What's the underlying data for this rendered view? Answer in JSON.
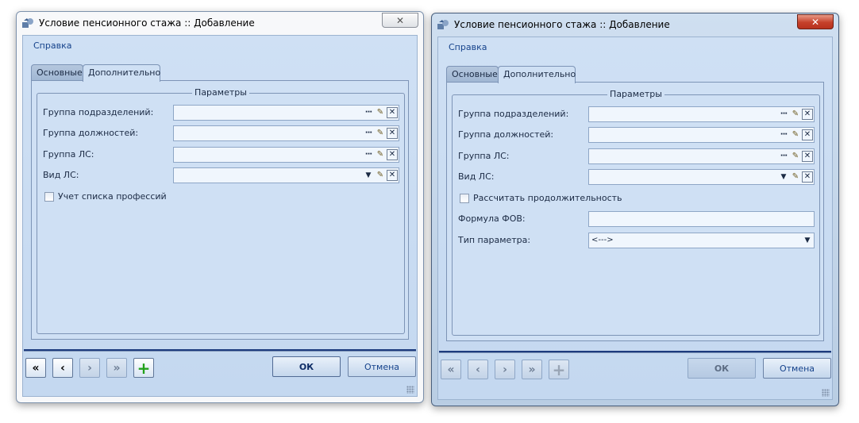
{
  "windows": [
    {
      "title": "Условие пенсионного стажа :: Добавление",
      "menu_item": "Справка",
      "tabs": [
        "Основные",
        "Дополнительно"
      ],
      "group_title": "Параметры",
      "fields": [
        {
          "label": "Группа подразделений:",
          "value": ""
        },
        {
          "label": "Группа должностей:",
          "value": ""
        },
        {
          "label": "Группа ЛС:",
          "value": ""
        },
        {
          "label": "Вид ЛС:",
          "value": ""
        }
      ],
      "checkbox_label": "Учет списка профессий",
      "ok_label": "ОК",
      "cancel_label": "Отмена"
    },
    {
      "title": "Условие пенсионного стажа :: Добавление",
      "menu_item": "Справка",
      "tabs": [
        "Основные",
        "Дополнительно"
      ],
      "group_title": "Параметры",
      "fields": [
        {
          "label": "Группа подразделений:",
          "value": ""
        },
        {
          "label": "Группа должностей:",
          "value": ""
        },
        {
          "label": "Группа ЛС:",
          "value": ""
        },
        {
          "label": "Вид ЛС:",
          "value": ""
        }
      ],
      "checkbox_label": "Рассчитать продолжительность",
      "formula_label": "Формула ФОВ:",
      "formula_value": "",
      "param_type_label": "Тип параметра:",
      "param_type_value": "<--->",
      "ok_label": "ОК",
      "cancel_label": "Отмена"
    }
  ],
  "icons": {
    "first": "double-chevron-left-icon",
    "prev": "chevron-left-icon",
    "next": "chevron-right-icon",
    "last": "double-chevron-right-icon",
    "add": "plus-icon",
    "ellipsis": "ellipsis-icon",
    "edit": "pencil-icon",
    "clear": "close-icon",
    "dropdown": "triangle-down-icon"
  },
  "colors": {
    "client_bg": "#cfe0f4",
    "accent_line": "#1d3b7e",
    "add_green": "#22a11a",
    "close_red": "#c5402a"
  }
}
